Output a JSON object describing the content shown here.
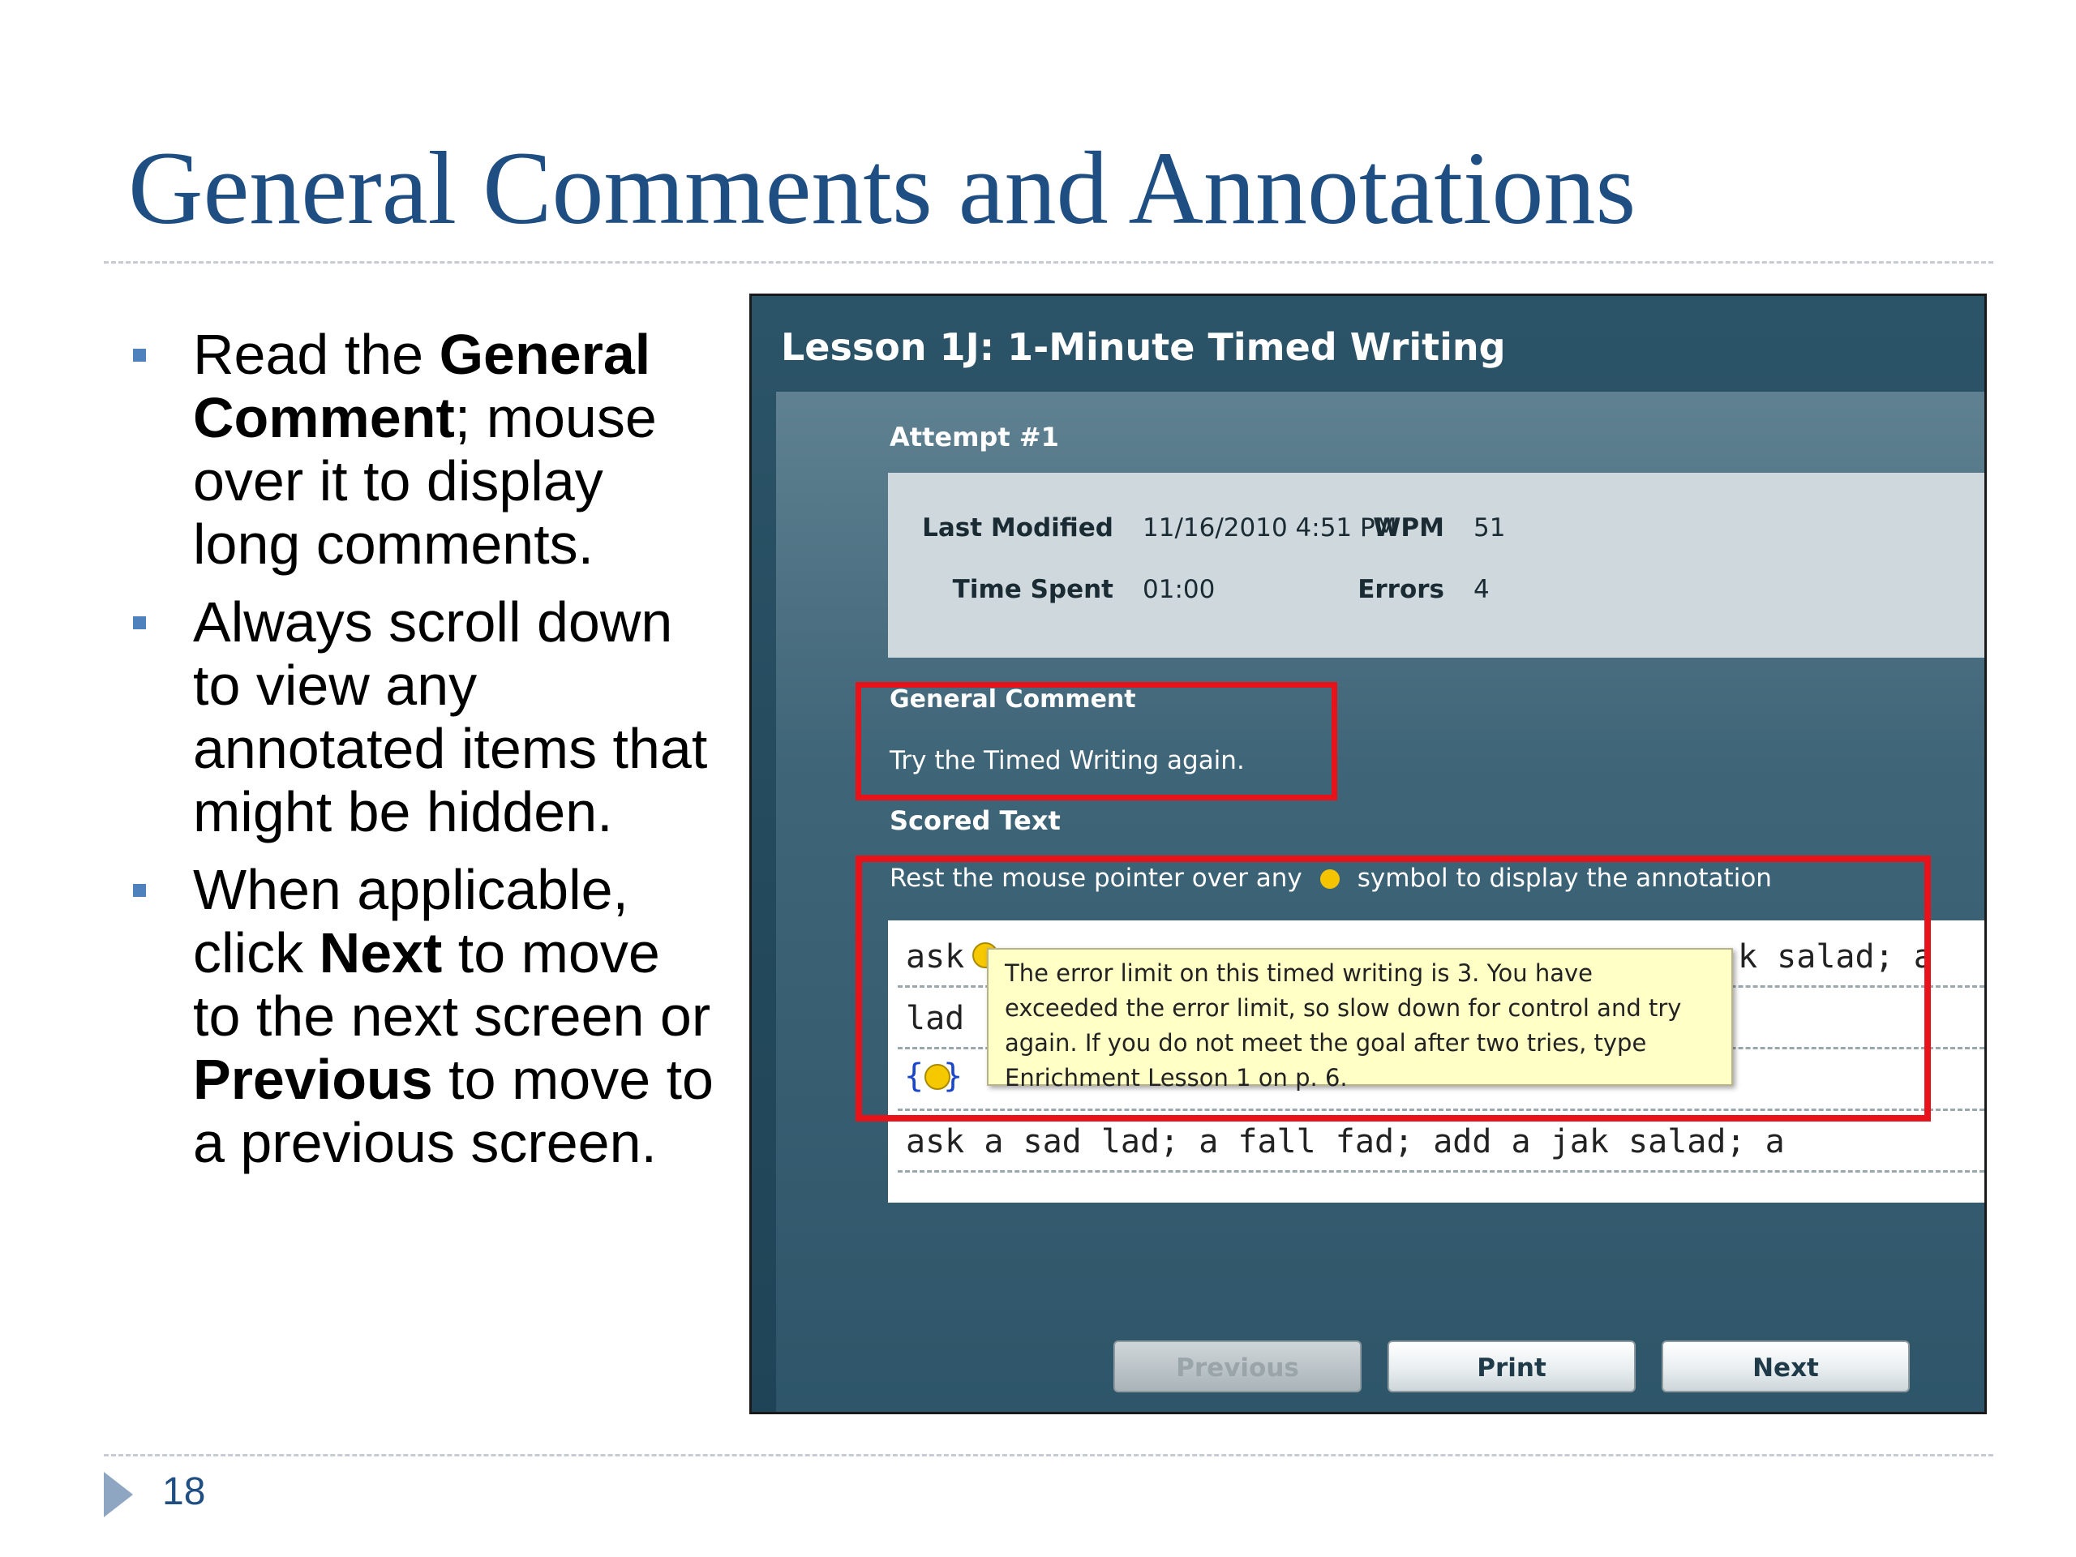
{
  "slide": {
    "title": "General Comments and Annotations",
    "page_number": "18"
  },
  "bullets": [
    {
      "pre": "Read the ",
      "bold": "General Comment",
      "post": "; mouse over it to display long comments."
    },
    {
      "text": "Always scroll down to view any annotated items that might be hidden."
    },
    {
      "pre": "When applicable, click ",
      "bold1": "Next",
      "mid": " to move to the next screen or ",
      "bold2": "Previous",
      "post": " to move to a previous screen."
    }
  ],
  "app": {
    "lesson_title": "Lesson 1J: 1-Minute Timed Writing",
    "attempt": "Attempt #1",
    "stats": {
      "last_modified_label": "Last Modified",
      "last_modified_value": "11/16/2010 4:51 PM",
      "wpm_label": "WPM",
      "wpm_value": "51",
      "time_spent_label": "Time Spent",
      "time_spent_value": "01:00",
      "errors_label": "Errors",
      "errors_value": "4"
    },
    "general_comment_label": "General Comment",
    "general_comment_text": "Try the Timed Writing again.",
    "scored_text_label": "Scored Text",
    "instruction_pre": "Rest the mouse pointer over any",
    "instruction_post": "symbol to display the annotation",
    "scored_lines": [
      "ask",
      "k salad; a",
      "lad",
      "ask a sad lad; a fall fad; add a jak salad; a"
    ],
    "brace_text": "{ }",
    "tooltip": [
      "The error limit on this timed writing is 3. You have",
      "exceeded the error limit, so slow down for control and try",
      "again. If you do not meet the goal after two tries, type",
      "Enrichment Lesson 1 on p. 6."
    ],
    "buttons": {
      "previous": "Previous",
      "print": "Print",
      "next": "Next"
    },
    "colors": {
      "highlight_red": "#e8131a",
      "annotation_yellow": "#f6c800",
      "title_blue": "#1f4e82"
    }
  }
}
